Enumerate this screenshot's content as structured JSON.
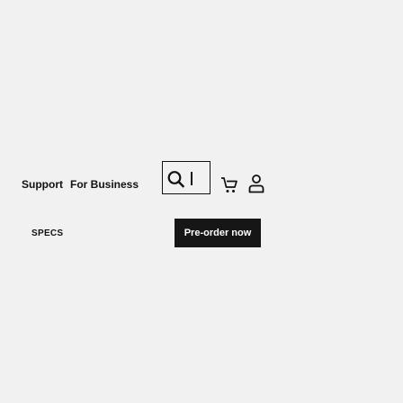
{
  "header": {
    "nav": [
      {
        "label": "Support"
      },
      {
        "label": "For Business"
      }
    ],
    "icons": {
      "search": "search-icon",
      "cart": "cart-icon",
      "account": "user-icon"
    }
  },
  "subnav": {
    "specs_label": "SPECS",
    "preorder_label": "Pre-order now"
  },
  "colors": {
    "background": "#f1f1f1",
    "text": "#111111",
    "button_bg": "#161616",
    "button_text": "#ffffff"
  }
}
